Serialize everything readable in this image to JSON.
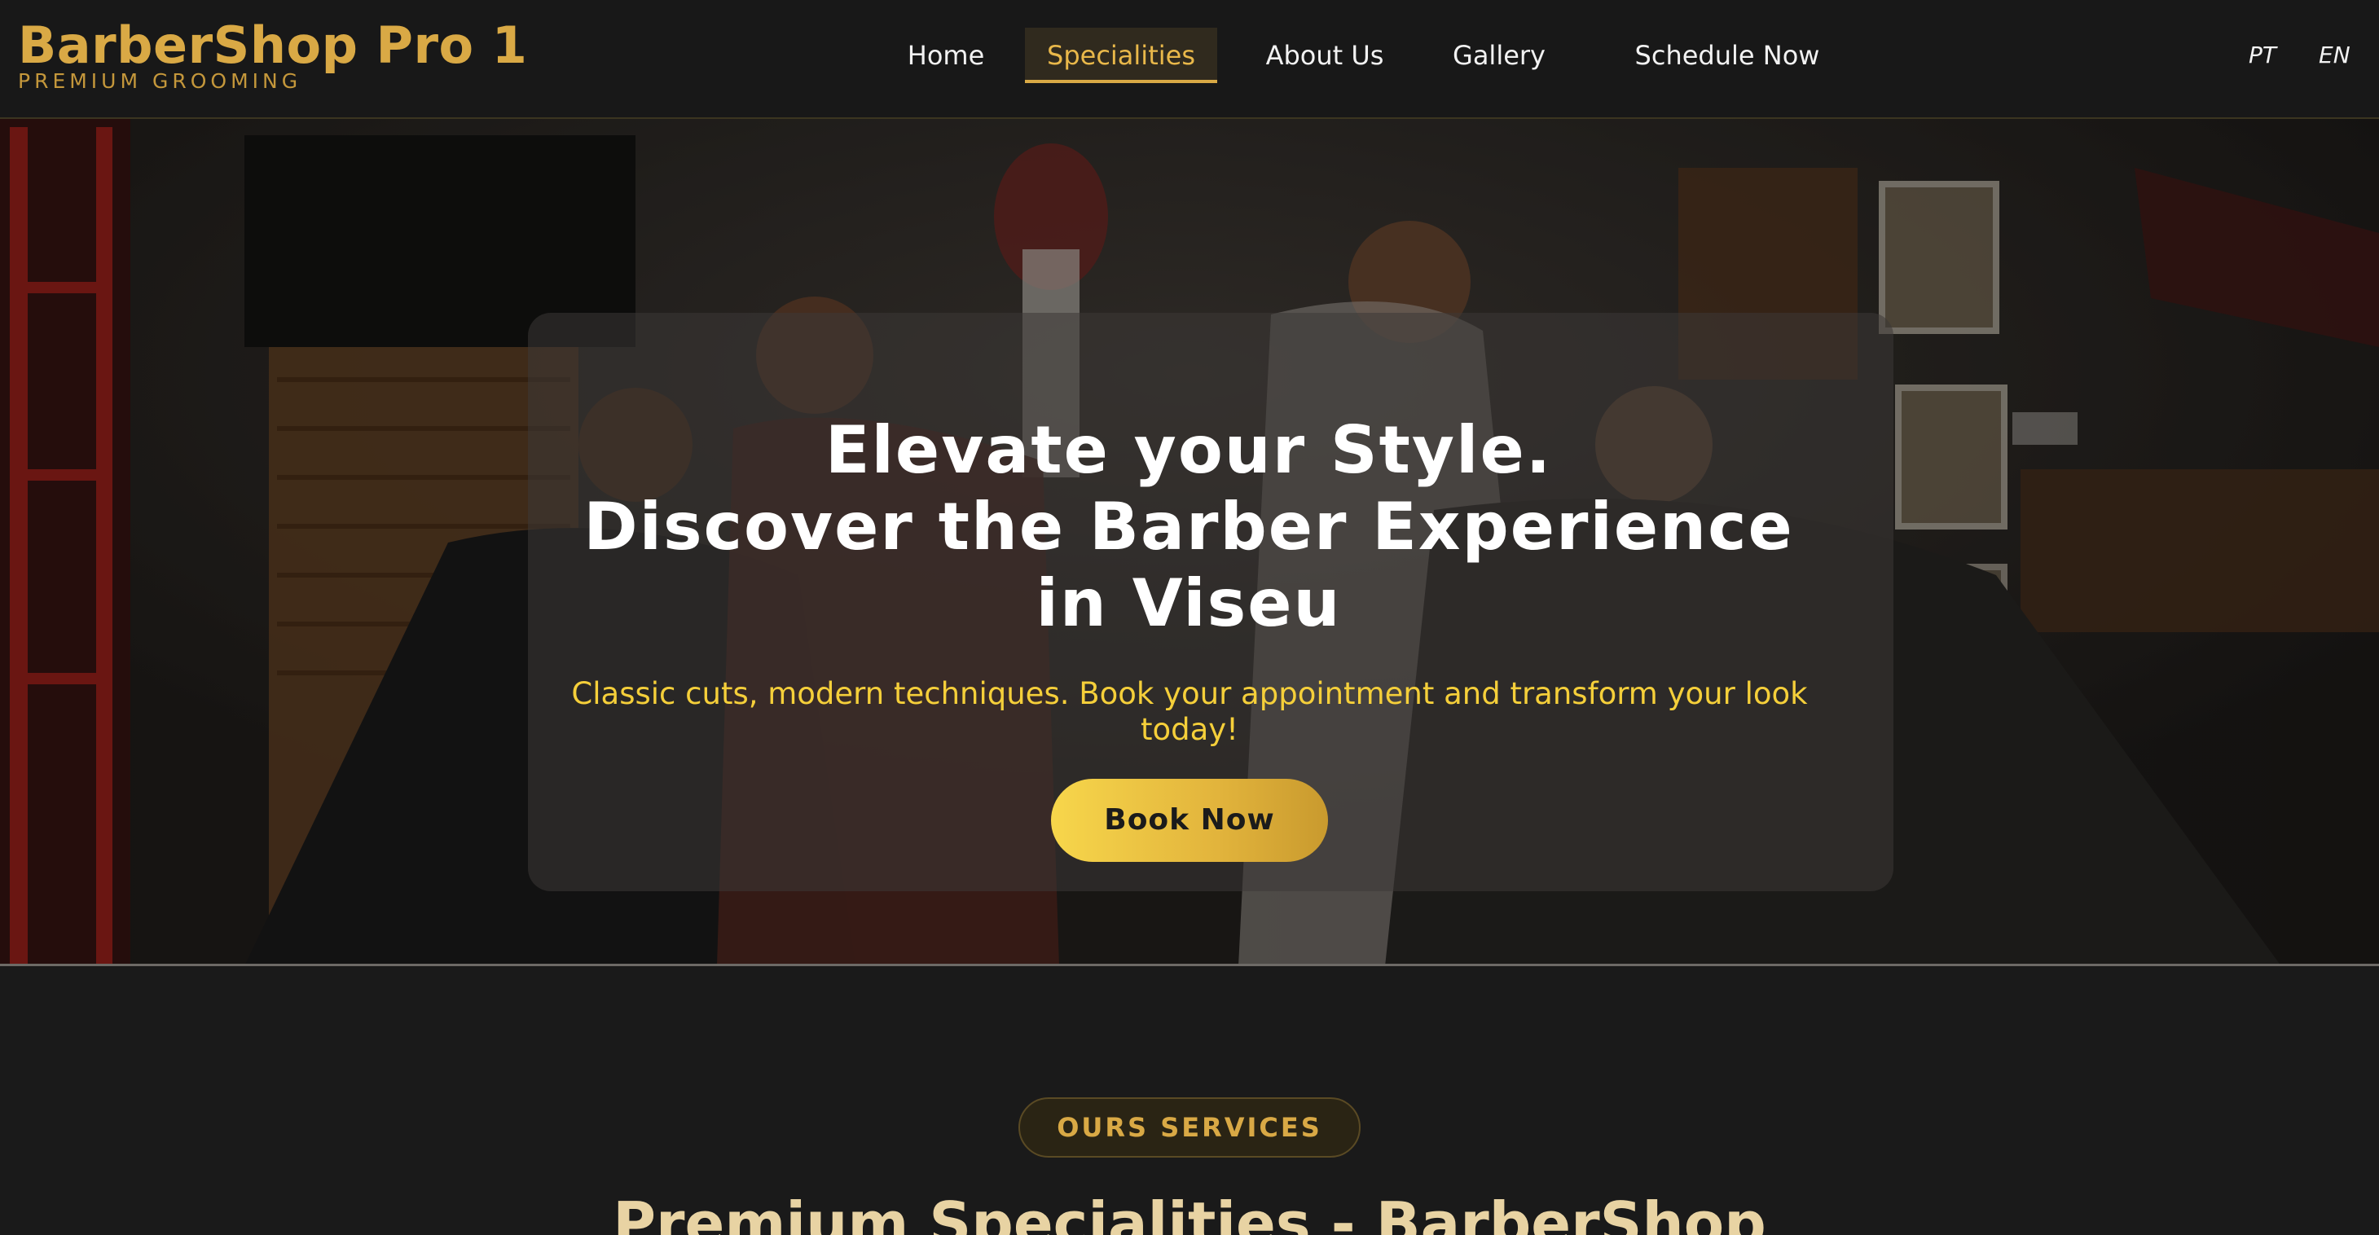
{
  "brand": {
    "title": "BarberShop Pro 1",
    "subtitle": "PREMIUM GROOMING",
    "color": "#d9a945"
  },
  "nav": {
    "items": [
      {
        "label": "Home",
        "active": false
      },
      {
        "label": "Specialities",
        "active": true
      },
      {
        "label": "About Us",
        "active": false
      },
      {
        "label": "Gallery",
        "active": false
      },
      {
        "label": "Schedule Now",
        "active": false
      }
    ],
    "languages": [
      "PT",
      "EN"
    ]
  },
  "hero": {
    "title_lines": [
      "Elevate your Style.",
      "Discover the Barber Experience",
      "in Viseu"
    ],
    "subtitle": "Classic cuts, modern techniques. Book your appointment and transform your look today!",
    "button_label": "Book Now",
    "accent_color": "#f5cf3a"
  },
  "services": {
    "badge": "OURS SERVICES",
    "title": "Premium Specialities - BarberShop"
  }
}
